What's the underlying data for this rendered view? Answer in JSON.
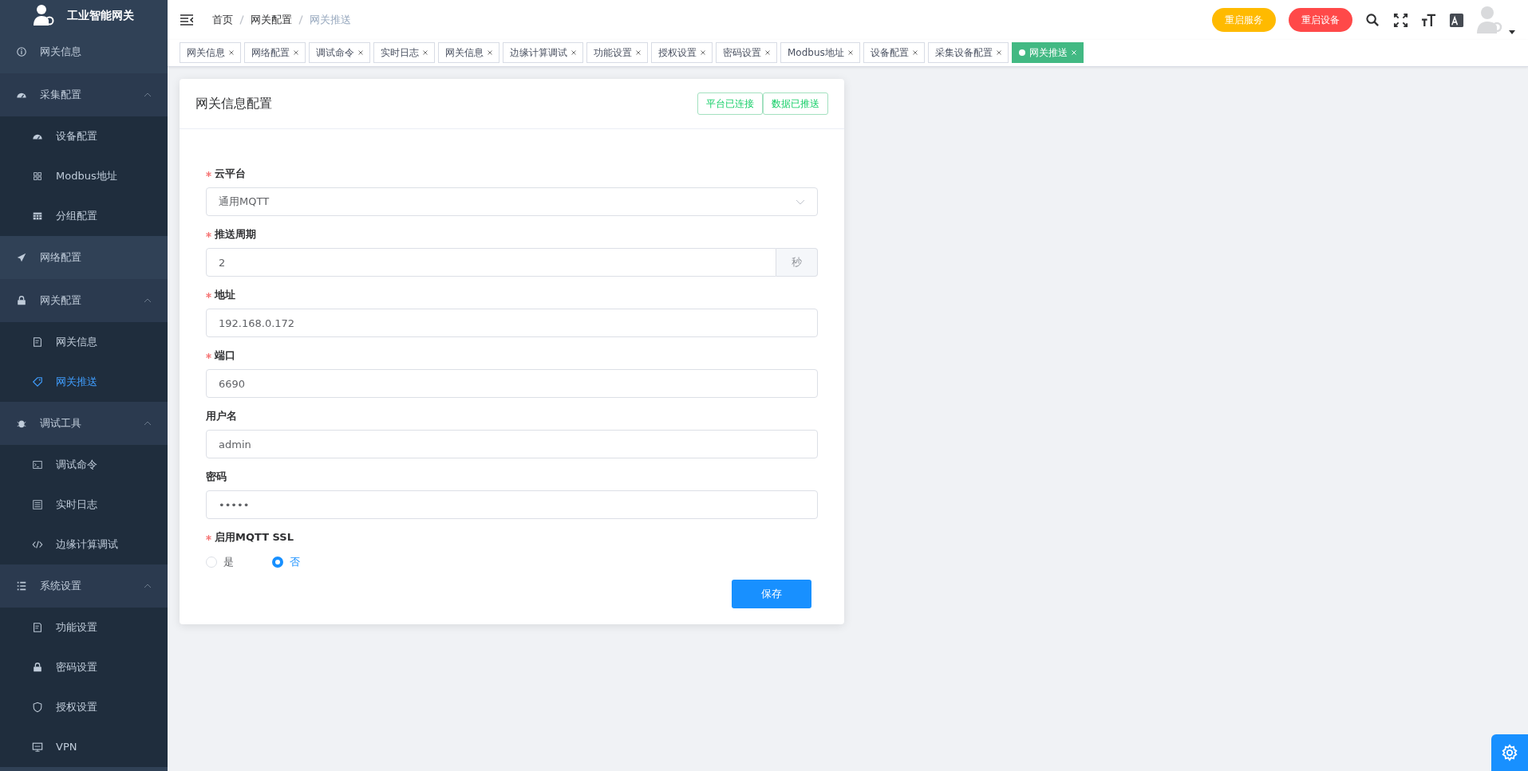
{
  "sidebar": {
    "title": "工业智能网关",
    "items": [
      {
        "label": "网关信息",
        "selected": false
      },
      {
        "label": "采集配置",
        "expanded": true,
        "selected": false,
        "children": [
          {
            "label": "设备配置",
            "selected": false
          },
          {
            "label": "Modbus地址",
            "selected": false
          },
          {
            "label": "分组配置",
            "selected": false
          }
        ]
      },
      {
        "label": "网络配置",
        "selected": false
      },
      {
        "label": "网关配置",
        "expanded": true,
        "selected": false,
        "children": [
          {
            "label": "网关信息",
            "selected": false
          },
          {
            "label": "网关推送",
            "selected": true
          }
        ]
      },
      {
        "label": "调试工具",
        "expanded": true,
        "selected": false,
        "children": [
          {
            "label": "调试命令",
            "selected": false
          },
          {
            "label": "实时日志",
            "selected": false
          },
          {
            "label": "边缘计算调试",
            "selected": false
          }
        ]
      },
      {
        "label": "系统设置",
        "expanded": true,
        "selected": false,
        "children": [
          {
            "label": "功能设置",
            "selected": false
          },
          {
            "label": "密码设置",
            "selected": false
          },
          {
            "label": "授权设置",
            "selected": false
          },
          {
            "label": "VPN",
            "selected": false
          }
        ]
      }
    ]
  },
  "breadcrumb": [
    "首页",
    "网关配置",
    "网关推送"
  ],
  "header_buttons": [
    {
      "label": "重启服务",
      "kind": "warning"
    },
    {
      "label": "重启设备",
      "kind": "danger"
    }
  ],
  "tabs": [
    {
      "label": "网关信息",
      "selected": false
    },
    {
      "label": "网络配置",
      "selected": false
    },
    {
      "label": "调试命令",
      "selected": false
    },
    {
      "label": "实时日志",
      "selected": false
    },
    {
      "label": "网关信息",
      "selected": false
    },
    {
      "label": "边缘计算调试",
      "selected": false
    },
    {
      "label": "功能设置",
      "selected": false
    },
    {
      "label": "授权设置",
      "selected": false
    },
    {
      "label": "密码设置",
      "selected": false
    },
    {
      "label": "Modbus地址",
      "selected": false
    },
    {
      "label": "设备配置",
      "selected": false
    },
    {
      "label": "采集设备配置",
      "selected": false
    },
    {
      "label": "网关推送",
      "selected": true
    }
  ],
  "card": {
    "title": "网关信息配置",
    "status_tags": [
      "平台已连接",
      "数据已推送"
    ],
    "fields": [
      {
        "kind": "select",
        "label": "云平台",
        "required": true,
        "value": "通用MQTT"
      },
      {
        "kind": "append",
        "label": "推送周期",
        "required": true,
        "value": "2",
        "suffix": "秒"
      },
      {
        "kind": "input",
        "label": "地址",
        "required": true,
        "value": "192.168.0.172"
      },
      {
        "kind": "input",
        "label": "端口",
        "required": true,
        "value": "6690"
      },
      {
        "kind": "input",
        "label": "用户名",
        "required": false,
        "value": "admin"
      },
      {
        "kind": "input",
        "label": "密码",
        "required": false,
        "value": "•••••"
      },
      {
        "kind": "radio",
        "label": "启用MQTT SSL",
        "required": true,
        "options": [
          {
            "label": "是",
            "selected": false
          },
          {
            "label": "否",
            "selected": true
          }
        ]
      }
    ],
    "save_button": "保存"
  }
}
